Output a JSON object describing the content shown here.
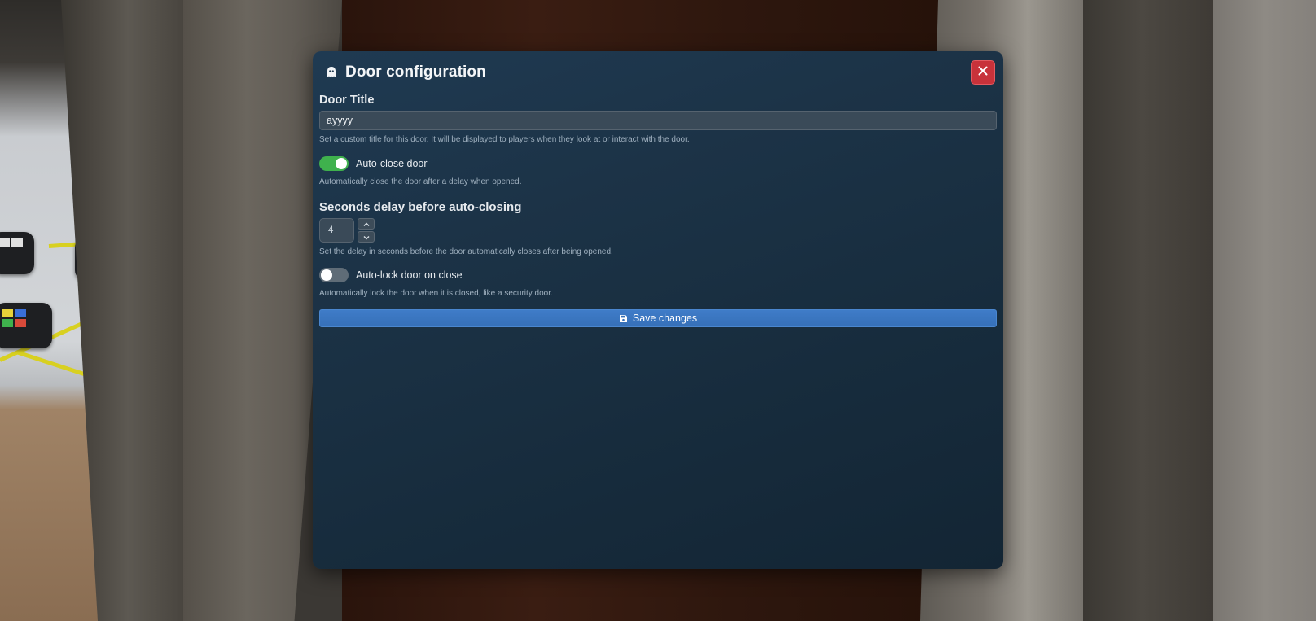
{
  "modal": {
    "title": "Door configuration",
    "title_icon": "ghost-icon",
    "close_icon": "close-icon"
  },
  "door_title": {
    "label": "Door Title",
    "value": "ayyyy",
    "help": "Set a custom title for this door. It will be displayed to players when they look at or interact with the door."
  },
  "auto_close": {
    "label": "Auto-close door",
    "enabled": true,
    "help": "Automatically close the door after a delay when opened."
  },
  "delay": {
    "heading": "Seconds delay before auto-closing",
    "value": "4",
    "help": "Set the delay in seconds before the door automatically closes after being opened."
  },
  "auto_lock": {
    "label": "Auto-lock door on close",
    "enabled": false,
    "help": "Automatically lock the door when it is closed, like a security door."
  },
  "save": {
    "label": "Save changes",
    "icon": "floppy-disk-icon"
  },
  "colors": {
    "toggle_on": "#3fb14d",
    "toggle_off": "#5f6c77",
    "close_button": "#c8323a",
    "save_button": "#3a76c0"
  }
}
